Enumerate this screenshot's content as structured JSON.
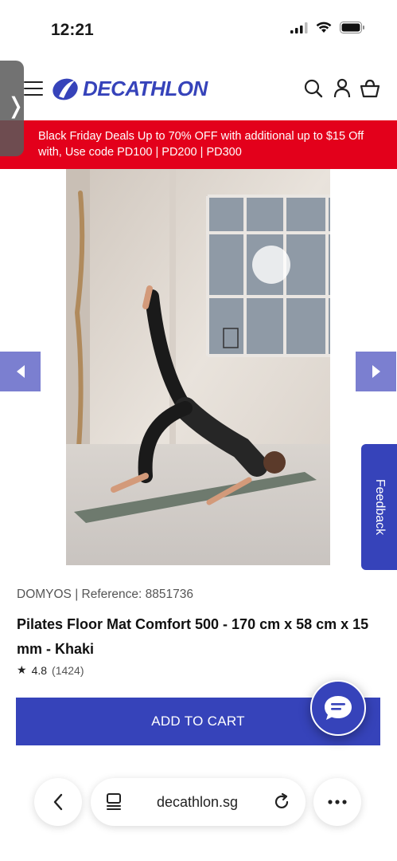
{
  "status_bar": {
    "time": "12:21"
  },
  "header": {
    "brand": "DECATHLON"
  },
  "promo": {
    "text": "Black Friday Deals Up to 70% OFF with additional up to $15 Off with, Use code PD100 | PD200 | PD300"
  },
  "feedback": {
    "label": "Feedback"
  },
  "product": {
    "brand_reference": "DOMYOS | Reference: 8851736",
    "title": "Pilates Floor Mat Comfort 500 - 170 cm x 58 cm x 15 mm - Khaki",
    "rating": "4.8",
    "review_count": "(1424)"
  },
  "cart": {
    "label": "ADD TO CART"
  },
  "browser": {
    "url": "decathlon.sg"
  },
  "colors": {
    "brand_blue": "#3643ba",
    "promo_red": "#e3001b",
    "arrow_bg": "#7b7fd0"
  }
}
